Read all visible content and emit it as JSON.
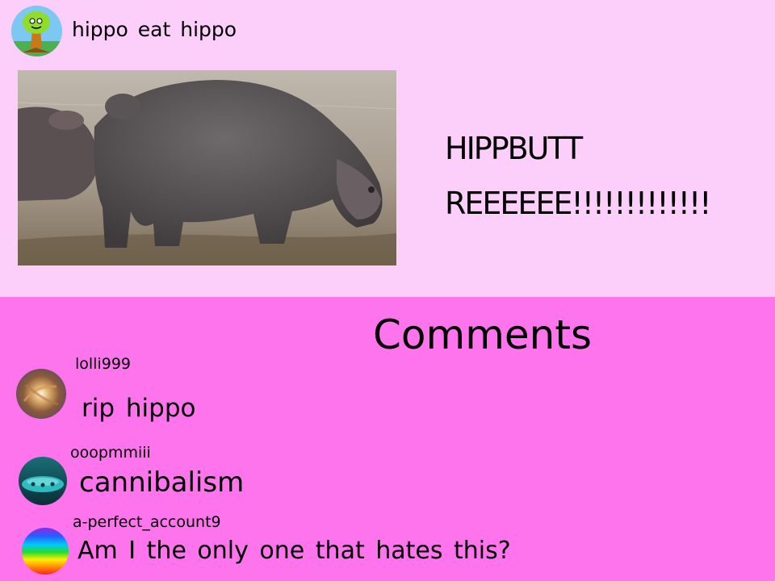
{
  "post": {
    "author": "hippo  eat  hippo",
    "image_alt": "hippo photo",
    "caption_line1": "HIPPBUTT",
    "caption_line2": "REEEEEE!!!!!!!!!!!!!"
  },
  "comments_section": {
    "title": "Comments",
    "items": [
      {
        "username": "lolli999",
        "text": "rip  hippo"
      },
      {
        "username": "ooopmmiii",
        "text": "cannibalism"
      },
      {
        "username": "a-perfect_account9",
        "text": "Am  I  the  only  one  that  hates  this?"
      }
    ]
  },
  "colors": {
    "post_background": "#fccffa",
    "comments_background": "#fd74ec"
  },
  "icons": {
    "author_avatar": "tree-avatar-icon",
    "comment_avatar_1": "galaxy-avatar-icon",
    "comment_avatar_2": "submarine-avatar-icon",
    "comment_avatar_3": "rainbow-avatar-icon"
  }
}
